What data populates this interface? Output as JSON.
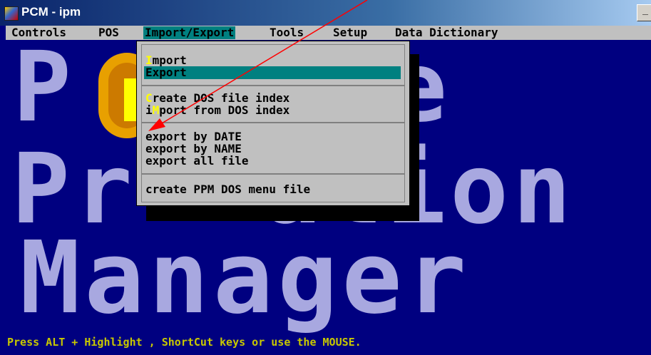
{
  "window": {
    "title": "PCM - ipm",
    "min_symbol": "_"
  },
  "menubar": {
    "items": [
      "Controls",
      "POS",
      "Import/Export",
      "Tools",
      "Setup",
      "Data Dictionary"
    ],
    "active": "Import/Export"
  },
  "background_text": {
    "row1": "P    re",
    "row2": "Pr  ation",
    "row3": "Manager"
  },
  "dropdown": {
    "import_pre": "",
    "import_hk": "I",
    "import_post": "mport",
    "export": "Export",
    "create_hk": "C",
    "create_post": "reate DOS file index",
    "iimport_pre": "i",
    "iimport_hk": "M",
    "iimport_post": "port from DOS index",
    "by_date": "export by DATE",
    "by_name": "export by NAME",
    "all_file": "export all file",
    "menu_file": "create PPM DOS menu file"
  },
  "status": {
    "text": "Press ALT + Highlight , ShortCut keys or use the MOUSE."
  },
  "colors": {
    "background": "#000080",
    "menu_bar": "#c0c0c0",
    "highlight": "#008080",
    "hotkey": "#ffff00",
    "status_text": "#c8c800",
    "annotation_arrow": "#ff0000"
  }
}
